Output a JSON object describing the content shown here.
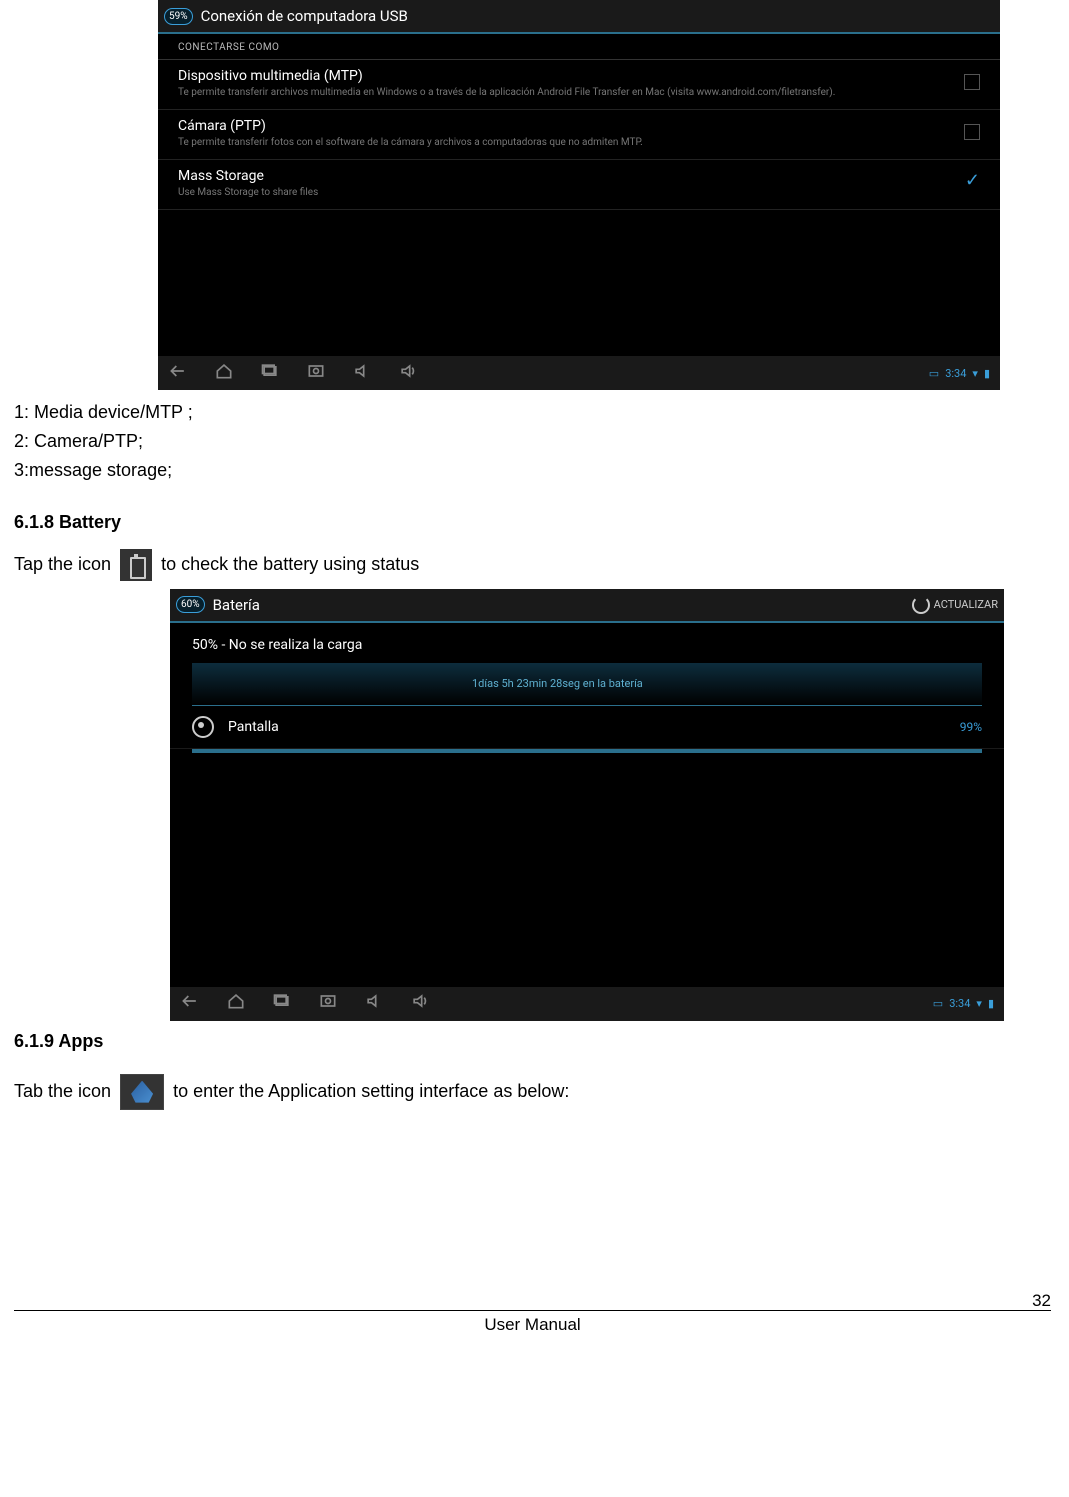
{
  "usb_screen": {
    "pct": "59%",
    "title": "Conexión de computadora USB",
    "section_label": "CONECTARSE COMO",
    "options": [
      {
        "title": "Dispositivo multimedia (MTP)",
        "sub": "Te permite transferir archivos multimedia en Windows o a través de la aplicación Android File Transfer en Mac (visita www.android.com/filetransfer).",
        "checkbox": true,
        "checked": false
      },
      {
        "title": "Cámara (PTP)",
        "sub": "Te permite transferir fotos con el software de la cámara y archivos a computadoras que no admiten MTP.",
        "checkbox": true,
        "checked": false
      },
      {
        "title": "Mass Storage",
        "sub": "Use Mass Storage to share files",
        "checkbox": false,
        "checked": true
      }
    ],
    "clock": "3:34"
  },
  "body": {
    "line1": "1: Media device/MTP ;",
    "line2": "2: Camera/PTP;",
    "line3": "3:message storage;",
    "heading_battery": "6.1.8 Battery",
    "tap_pre": "Tap the icon",
    "tap_post": "to check the battery using status",
    "heading_apps": "6.1.9 Apps",
    "tab_pre": "Tab the icon",
    "tab_post": "to enter the Application setting interface as below:"
  },
  "battery_screen": {
    "pct": "60%",
    "title": "Batería",
    "action": "ACTUALIZAR",
    "status": "50% - No se realiza la carga",
    "chart_label": "1días 5h 23min 28seg en la batería",
    "row_title": "Pantalla",
    "row_pct": "99%",
    "clock": "3:34"
  },
  "footer": {
    "center": "User Manual",
    "right": "32"
  }
}
